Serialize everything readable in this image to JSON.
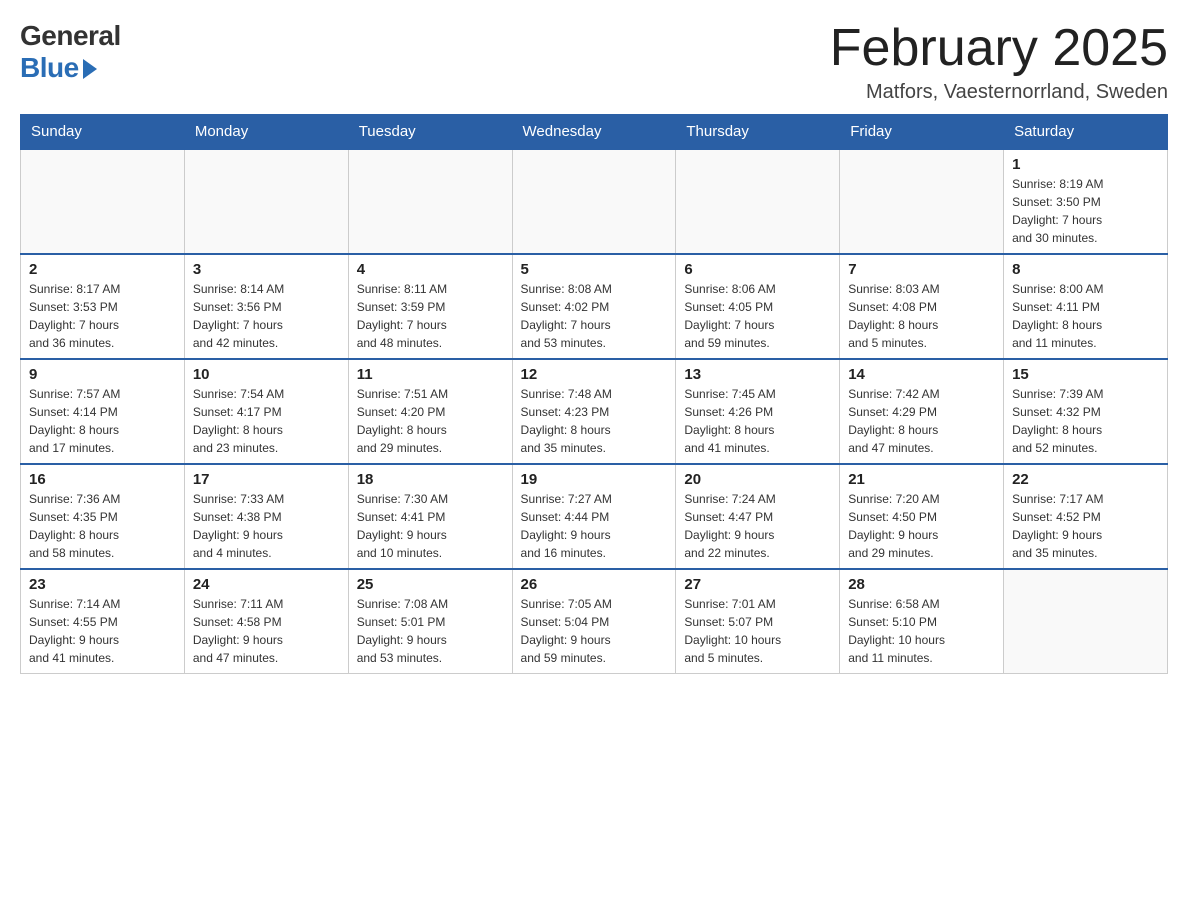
{
  "logo": {
    "general": "General",
    "blue": "Blue"
  },
  "header": {
    "title": "February 2025",
    "location": "Matfors, Vaesternorrland, Sweden"
  },
  "days_of_week": [
    "Sunday",
    "Monday",
    "Tuesday",
    "Wednesday",
    "Thursday",
    "Friday",
    "Saturday"
  ],
  "weeks": [
    [
      {
        "day": "",
        "info": ""
      },
      {
        "day": "",
        "info": ""
      },
      {
        "day": "",
        "info": ""
      },
      {
        "day": "",
        "info": ""
      },
      {
        "day": "",
        "info": ""
      },
      {
        "day": "",
        "info": ""
      },
      {
        "day": "1",
        "info": "Sunrise: 8:19 AM\nSunset: 3:50 PM\nDaylight: 7 hours\nand 30 minutes."
      }
    ],
    [
      {
        "day": "2",
        "info": "Sunrise: 8:17 AM\nSunset: 3:53 PM\nDaylight: 7 hours\nand 36 minutes."
      },
      {
        "day": "3",
        "info": "Sunrise: 8:14 AM\nSunset: 3:56 PM\nDaylight: 7 hours\nand 42 minutes."
      },
      {
        "day": "4",
        "info": "Sunrise: 8:11 AM\nSunset: 3:59 PM\nDaylight: 7 hours\nand 48 minutes."
      },
      {
        "day": "5",
        "info": "Sunrise: 8:08 AM\nSunset: 4:02 PM\nDaylight: 7 hours\nand 53 minutes."
      },
      {
        "day": "6",
        "info": "Sunrise: 8:06 AM\nSunset: 4:05 PM\nDaylight: 7 hours\nand 59 minutes."
      },
      {
        "day": "7",
        "info": "Sunrise: 8:03 AM\nSunset: 4:08 PM\nDaylight: 8 hours\nand 5 minutes."
      },
      {
        "day": "8",
        "info": "Sunrise: 8:00 AM\nSunset: 4:11 PM\nDaylight: 8 hours\nand 11 minutes."
      }
    ],
    [
      {
        "day": "9",
        "info": "Sunrise: 7:57 AM\nSunset: 4:14 PM\nDaylight: 8 hours\nand 17 minutes."
      },
      {
        "day": "10",
        "info": "Sunrise: 7:54 AM\nSunset: 4:17 PM\nDaylight: 8 hours\nand 23 minutes."
      },
      {
        "day": "11",
        "info": "Sunrise: 7:51 AM\nSunset: 4:20 PM\nDaylight: 8 hours\nand 29 minutes."
      },
      {
        "day": "12",
        "info": "Sunrise: 7:48 AM\nSunset: 4:23 PM\nDaylight: 8 hours\nand 35 minutes."
      },
      {
        "day": "13",
        "info": "Sunrise: 7:45 AM\nSunset: 4:26 PM\nDaylight: 8 hours\nand 41 minutes."
      },
      {
        "day": "14",
        "info": "Sunrise: 7:42 AM\nSunset: 4:29 PM\nDaylight: 8 hours\nand 47 minutes."
      },
      {
        "day": "15",
        "info": "Sunrise: 7:39 AM\nSunset: 4:32 PM\nDaylight: 8 hours\nand 52 minutes."
      }
    ],
    [
      {
        "day": "16",
        "info": "Sunrise: 7:36 AM\nSunset: 4:35 PM\nDaylight: 8 hours\nand 58 minutes."
      },
      {
        "day": "17",
        "info": "Sunrise: 7:33 AM\nSunset: 4:38 PM\nDaylight: 9 hours\nand 4 minutes."
      },
      {
        "day": "18",
        "info": "Sunrise: 7:30 AM\nSunset: 4:41 PM\nDaylight: 9 hours\nand 10 minutes."
      },
      {
        "day": "19",
        "info": "Sunrise: 7:27 AM\nSunset: 4:44 PM\nDaylight: 9 hours\nand 16 minutes."
      },
      {
        "day": "20",
        "info": "Sunrise: 7:24 AM\nSunset: 4:47 PM\nDaylight: 9 hours\nand 22 minutes."
      },
      {
        "day": "21",
        "info": "Sunrise: 7:20 AM\nSunset: 4:50 PM\nDaylight: 9 hours\nand 29 minutes."
      },
      {
        "day": "22",
        "info": "Sunrise: 7:17 AM\nSunset: 4:52 PM\nDaylight: 9 hours\nand 35 minutes."
      }
    ],
    [
      {
        "day": "23",
        "info": "Sunrise: 7:14 AM\nSunset: 4:55 PM\nDaylight: 9 hours\nand 41 minutes."
      },
      {
        "day": "24",
        "info": "Sunrise: 7:11 AM\nSunset: 4:58 PM\nDaylight: 9 hours\nand 47 minutes."
      },
      {
        "day": "25",
        "info": "Sunrise: 7:08 AM\nSunset: 5:01 PM\nDaylight: 9 hours\nand 53 minutes."
      },
      {
        "day": "26",
        "info": "Sunrise: 7:05 AM\nSunset: 5:04 PM\nDaylight: 9 hours\nand 59 minutes."
      },
      {
        "day": "27",
        "info": "Sunrise: 7:01 AM\nSunset: 5:07 PM\nDaylight: 10 hours\nand 5 minutes."
      },
      {
        "day": "28",
        "info": "Sunrise: 6:58 AM\nSunset: 5:10 PM\nDaylight: 10 hours\nand 11 minutes."
      },
      {
        "day": "",
        "info": ""
      }
    ]
  ]
}
